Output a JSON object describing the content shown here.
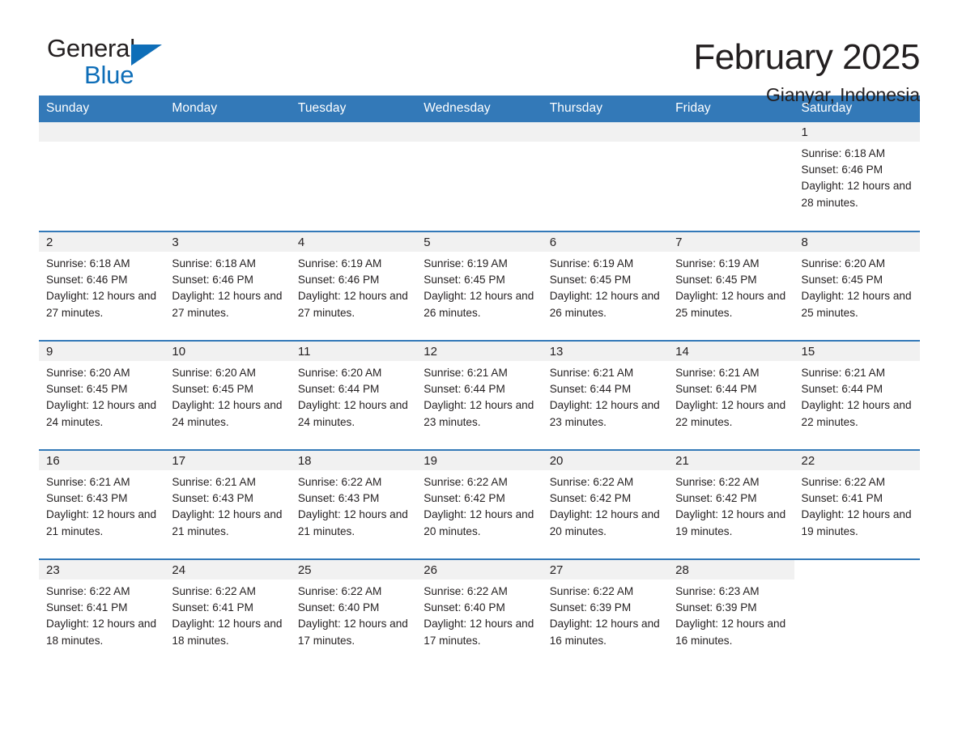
{
  "brand": {
    "name_part1": "General",
    "name_part2": "Blue",
    "accent_color": "#0e6eb8",
    "triangle_icon": "brand-triangle-icon"
  },
  "header": {
    "title": "February 2025",
    "subtitle": "Gianyar, Indonesia"
  },
  "calendar": {
    "header_bg": "#3379b8",
    "daynum_bg": "#f1f1f1",
    "columns": [
      "Sunday",
      "Monday",
      "Tuesday",
      "Wednesday",
      "Thursday",
      "Friday",
      "Saturday"
    ],
    "labels": {
      "sunrise": "Sunrise:",
      "sunset": "Sunset:",
      "daylight": "Daylight:"
    },
    "weeks": [
      [
        {
          "day": "",
          "blank": true
        },
        {
          "day": "",
          "blank": true
        },
        {
          "day": "",
          "blank": true
        },
        {
          "day": "",
          "blank": true
        },
        {
          "day": "",
          "blank": true
        },
        {
          "day": "",
          "blank": true
        },
        {
          "day": "1",
          "sunrise": "Sunrise: 6:18 AM",
          "sunset": "Sunset: 6:46 PM",
          "daylight": "Daylight: 12 hours and 28 minutes."
        }
      ],
      [
        {
          "day": "2",
          "sunrise": "Sunrise: 6:18 AM",
          "sunset": "Sunset: 6:46 PM",
          "daylight": "Daylight: 12 hours and 27 minutes."
        },
        {
          "day": "3",
          "sunrise": "Sunrise: 6:18 AM",
          "sunset": "Sunset: 6:46 PM",
          "daylight": "Daylight: 12 hours and 27 minutes."
        },
        {
          "day": "4",
          "sunrise": "Sunrise: 6:19 AM",
          "sunset": "Sunset: 6:46 PM",
          "daylight": "Daylight: 12 hours and 27 minutes."
        },
        {
          "day": "5",
          "sunrise": "Sunrise: 6:19 AM",
          "sunset": "Sunset: 6:45 PM",
          "daylight": "Daylight: 12 hours and 26 minutes."
        },
        {
          "day": "6",
          "sunrise": "Sunrise: 6:19 AM",
          "sunset": "Sunset: 6:45 PM",
          "daylight": "Daylight: 12 hours and 26 minutes."
        },
        {
          "day": "7",
          "sunrise": "Sunrise: 6:19 AM",
          "sunset": "Sunset: 6:45 PM",
          "daylight": "Daylight: 12 hours and 25 minutes."
        },
        {
          "day": "8",
          "sunrise": "Sunrise: 6:20 AM",
          "sunset": "Sunset: 6:45 PM",
          "daylight": "Daylight: 12 hours and 25 minutes."
        }
      ],
      [
        {
          "day": "9",
          "sunrise": "Sunrise: 6:20 AM",
          "sunset": "Sunset: 6:45 PM",
          "daylight": "Daylight: 12 hours and 24 minutes."
        },
        {
          "day": "10",
          "sunrise": "Sunrise: 6:20 AM",
          "sunset": "Sunset: 6:45 PM",
          "daylight": "Daylight: 12 hours and 24 minutes."
        },
        {
          "day": "11",
          "sunrise": "Sunrise: 6:20 AM",
          "sunset": "Sunset: 6:44 PM",
          "daylight": "Daylight: 12 hours and 24 minutes."
        },
        {
          "day": "12",
          "sunrise": "Sunrise: 6:21 AM",
          "sunset": "Sunset: 6:44 PM",
          "daylight": "Daylight: 12 hours and 23 minutes."
        },
        {
          "day": "13",
          "sunrise": "Sunrise: 6:21 AM",
          "sunset": "Sunset: 6:44 PM",
          "daylight": "Daylight: 12 hours and 23 minutes."
        },
        {
          "day": "14",
          "sunrise": "Sunrise: 6:21 AM",
          "sunset": "Sunset: 6:44 PM",
          "daylight": "Daylight: 12 hours and 22 minutes."
        },
        {
          "day": "15",
          "sunrise": "Sunrise: 6:21 AM",
          "sunset": "Sunset: 6:44 PM",
          "daylight": "Daylight: 12 hours and 22 minutes."
        }
      ],
      [
        {
          "day": "16",
          "sunrise": "Sunrise: 6:21 AM",
          "sunset": "Sunset: 6:43 PM",
          "daylight": "Daylight: 12 hours and 21 minutes."
        },
        {
          "day": "17",
          "sunrise": "Sunrise: 6:21 AM",
          "sunset": "Sunset: 6:43 PM",
          "daylight": "Daylight: 12 hours and 21 minutes."
        },
        {
          "day": "18",
          "sunrise": "Sunrise: 6:22 AM",
          "sunset": "Sunset: 6:43 PM",
          "daylight": "Daylight: 12 hours and 21 minutes."
        },
        {
          "day": "19",
          "sunrise": "Sunrise: 6:22 AM",
          "sunset": "Sunset: 6:42 PM",
          "daylight": "Daylight: 12 hours and 20 minutes."
        },
        {
          "day": "20",
          "sunrise": "Sunrise: 6:22 AM",
          "sunset": "Sunset: 6:42 PM",
          "daylight": "Daylight: 12 hours and 20 minutes."
        },
        {
          "day": "21",
          "sunrise": "Sunrise: 6:22 AM",
          "sunset": "Sunset: 6:42 PM",
          "daylight": "Daylight: 12 hours and 19 minutes."
        },
        {
          "day": "22",
          "sunrise": "Sunrise: 6:22 AM",
          "sunset": "Sunset: 6:41 PM",
          "daylight": "Daylight: 12 hours and 19 minutes."
        }
      ],
      [
        {
          "day": "23",
          "sunrise": "Sunrise: 6:22 AM",
          "sunset": "Sunset: 6:41 PM",
          "daylight": "Daylight: 12 hours and 18 minutes."
        },
        {
          "day": "24",
          "sunrise": "Sunrise: 6:22 AM",
          "sunset": "Sunset: 6:41 PM",
          "daylight": "Daylight: 12 hours and 18 minutes."
        },
        {
          "day": "25",
          "sunrise": "Sunrise: 6:22 AM",
          "sunset": "Sunset: 6:40 PM",
          "daylight": "Daylight: 12 hours and 17 minutes."
        },
        {
          "day": "26",
          "sunrise": "Sunrise: 6:22 AM",
          "sunset": "Sunset: 6:40 PM",
          "daylight": "Daylight: 12 hours and 17 minutes."
        },
        {
          "day": "27",
          "sunrise": "Sunrise: 6:22 AM",
          "sunset": "Sunset: 6:39 PM",
          "daylight": "Daylight: 12 hours and 16 minutes."
        },
        {
          "day": "28",
          "sunrise": "Sunrise: 6:23 AM",
          "sunset": "Sunset: 6:39 PM",
          "daylight": "Daylight: 12 hours and 16 minutes."
        },
        {
          "day": "",
          "blank": true
        }
      ]
    ]
  }
}
